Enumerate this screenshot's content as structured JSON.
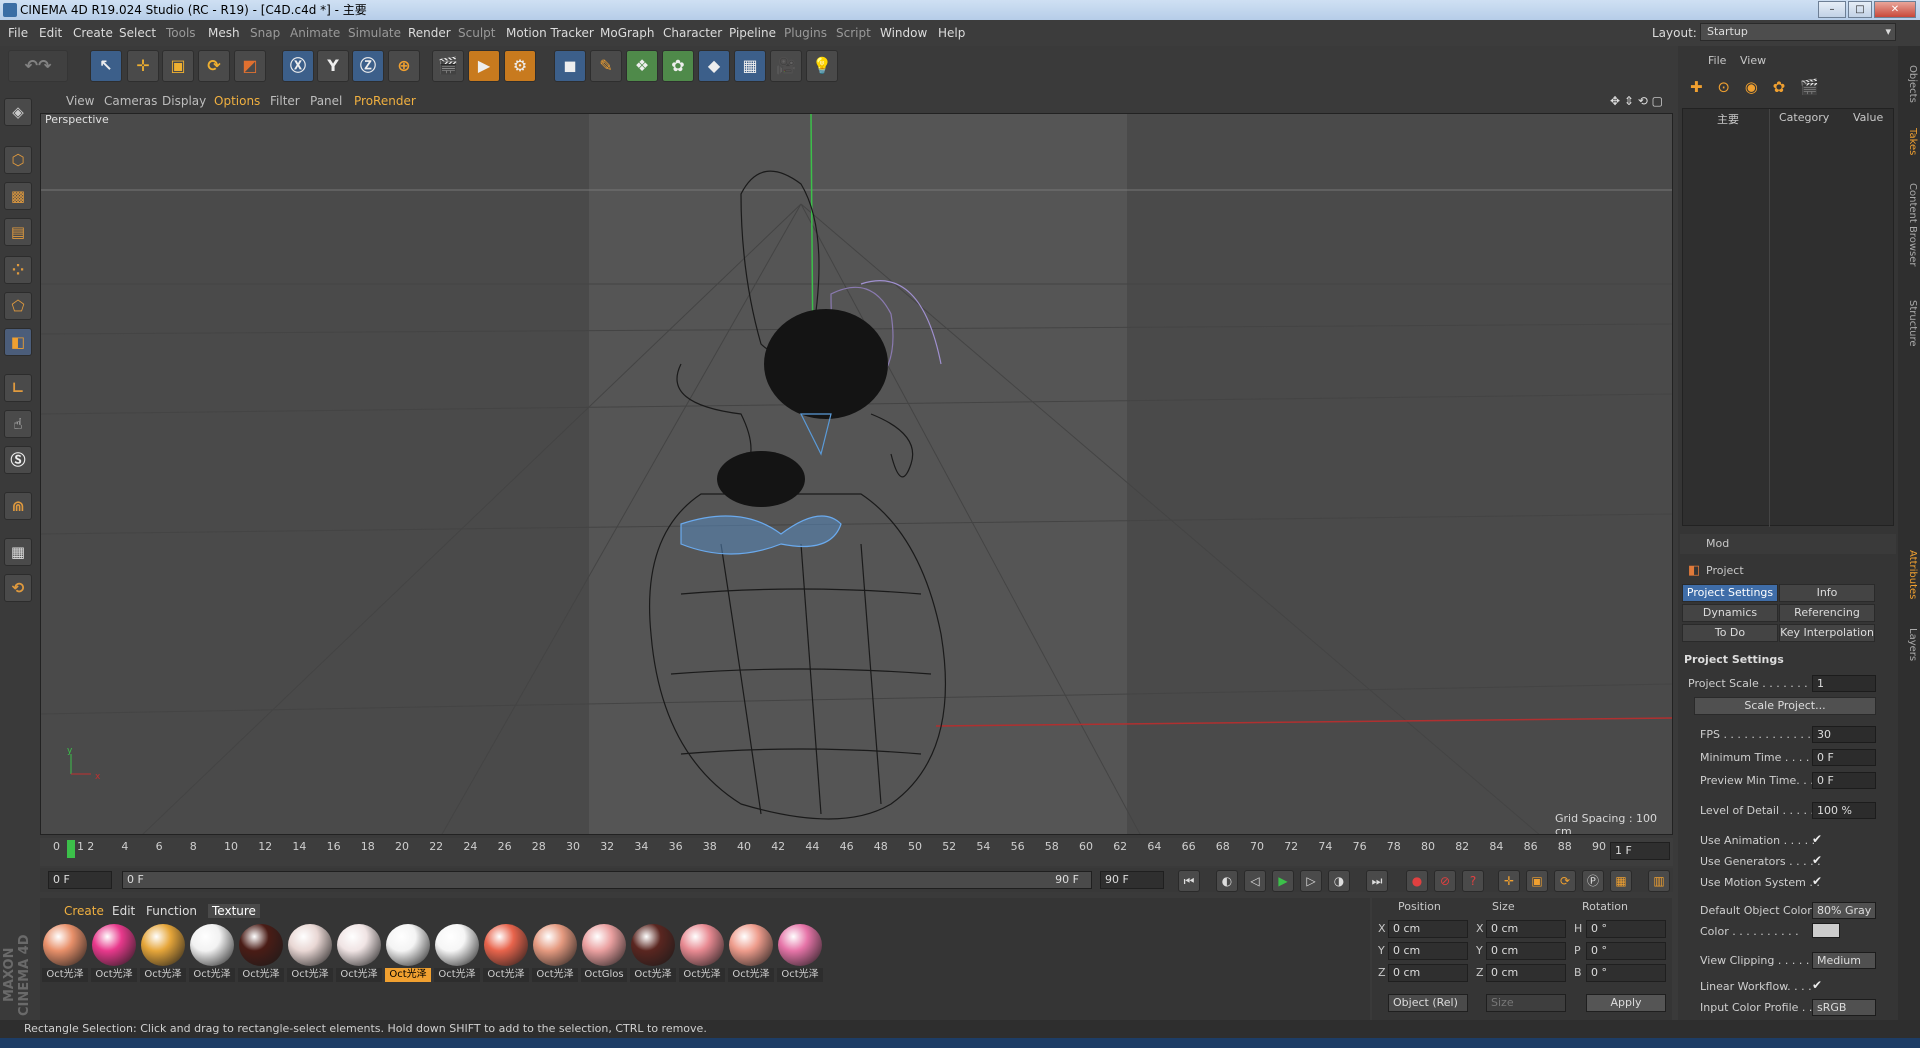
{
  "window": {
    "title": "CINEMA 4D R19.024 Studio (RC - R19) - [C4D.c4d *] - 主要"
  },
  "menu": [
    "File",
    "Edit",
    "Create",
    "Select",
    "Tools",
    "Mesh",
    "Snap",
    "Animate",
    "Simulate",
    "Render",
    "Sculpt",
    "Motion Tracker",
    "MoGraph",
    "Character",
    "Pipeline",
    "Plugins",
    "Script",
    "Window",
    "Help"
  ],
  "layout": {
    "label": "Layout:",
    "value": "Startup"
  },
  "viewport_menu": [
    "View",
    "Cameras",
    "Display",
    "Options",
    "Filter",
    "Panel",
    "ProRender"
  ],
  "viewport": {
    "name": "Perspective",
    "grid_spacing": "Grid Spacing : 100 cm",
    "axis_x": "x",
    "axis_y": "y"
  },
  "timeline": {
    "ticks": [
      "0",
      "2",
      "4",
      "6",
      "8",
      "10",
      "12",
      "14",
      "16",
      "18",
      "20",
      "22",
      "24",
      "26",
      "28",
      "30",
      "32",
      "34",
      "36",
      "38",
      "40",
      "42",
      "44",
      "46",
      "48",
      "50",
      "52",
      "54",
      "56",
      "58",
      "60",
      "62",
      "64",
      "66",
      "68",
      "70",
      "72",
      "74",
      "76",
      "78",
      "80",
      "82",
      "84",
      "86",
      "88",
      "90"
    ],
    "current": "1",
    "end_field": "1 F"
  },
  "playback": {
    "start": "0 F",
    "scrub_start": "0 F",
    "scrub_end": "90 F",
    "end": "90 F"
  },
  "materials": {
    "tabs": [
      "Create",
      "Edit",
      "Function",
      "Texture"
    ],
    "items": [
      {
        "label": "Oct光泽",
        "color": "#e8906a"
      },
      {
        "label": "Oct光泽",
        "color": "#e8398c"
      },
      {
        "label": "Oct光泽",
        "color": "#e6a63a"
      },
      {
        "label": "Oct光泽",
        "color": "#f2f2f2"
      },
      {
        "label": "Oct光泽",
        "color": "#4a1c16"
      },
      {
        "label": "Oct光泽",
        "color": "#e9d7d4"
      },
      {
        "label": "Oct光泽",
        "color": "#f0e4e4"
      },
      {
        "label": "Oct光泽",
        "color": "#f4f4f4"
      },
      {
        "label": "Oct光泽",
        "color": "#f6f6f6"
      },
      {
        "label": "Oct光泽",
        "color": "#e8644c"
      },
      {
        "label": "Oct光泽",
        "color": "#e59a80"
      },
      {
        "label": "OctGlos",
        "color": "#eaa0a0"
      },
      {
        "label": "Oct光泽",
        "color": "#5a2620"
      },
      {
        "label": "Oct光泽",
        "color": "#e88a92"
      },
      {
        "label": "Oct光泽",
        "color": "#ee9c8c"
      },
      {
        "label": "Oct光泽",
        "color": "#e674a8"
      }
    ]
  },
  "coords": {
    "headers": [
      "Position",
      "Size",
      "Rotation"
    ],
    "rows": [
      {
        "a": "X",
        "pos": "0 cm",
        "b": "X",
        "size": "0 cm",
        "c": "H",
        "rot": "0 °"
      },
      {
        "a": "Y",
        "pos": "0 cm",
        "b": "Y",
        "size": "0 cm",
        "c": "P",
        "rot": "0 °"
      },
      {
        "a": "Z",
        "pos": "0 cm",
        "b": "Z",
        "size": "0 cm",
        "c": "B",
        "rot": "0 °"
      }
    ],
    "mode": "Object (Rel)",
    "size_mode": "Size",
    "apply": "Apply"
  },
  "objects": {
    "menu": [
      "File",
      "View"
    ],
    "col_name": "主要",
    "col_category": "Category",
    "col_value": "Value"
  },
  "attributes": {
    "mode": "Mod",
    "title": "Project",
    "tabs": [
      "Project Settings",
      "Info",
      "Dynamics",
      "Referencing",
      "To Do",
      "Key Interpolation"
    ],
    "section": "Project Settings",
    "props": [
      {
        "label": "Project Scale . . . . . . .",
        "value": "1"
      },
      {
        "label": "FPS . . . . . . . . . . . . . .",
        "value": "30"
      },
      {
        "label": "Minimum Time . . . . . .",
        "value": "0 F"
      },
      {
        "label": "Preview Min Time. . . .",
        "value": "0 F"
      },
      {
        "label": "Level of Detail . . . . .",
        "value": "100 %"
      }
    ],
    "scale_button": "Scale Project...",
    "checks": [
      "Use Animation . . . . .",
      "Use Generators . . . . .",
      "Use Motion System . ."
    ],
    "default_color_label": "Default Object Color",
    "default_color_value": "80% Gray",
    "color_label": "Color . . . . . . . . . .",
    "view_clipping_label": "View Clipping . . . . . .",
    "view_clipping_value": "Medium",
    "linear_label": "Linear Workflow. . . .",
    "input_profile_label": "Input Color Profile . .",
    "input_profile_value": "sRGB"
  },
  "side_tabs": [
    "Objects",
    "Takes",
    "Content Browser",
    "Structure",
    "Attributes",
    "Layers"
  ],
  "status": "Rectangle Selection: Click and drag to rectangle-select elements. Hold down SHIFT to add to the selection, CTRL to remove.",
  "brand": "MAXON CINEMA 4D"
}
